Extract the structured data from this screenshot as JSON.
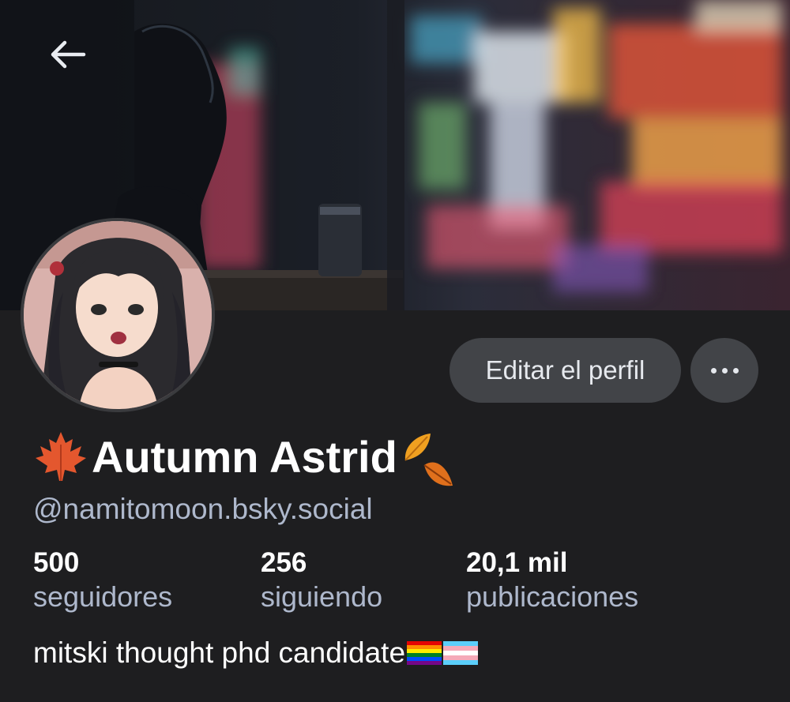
{
  "header": {
    "back_icon": "arrow-left-icon"
  },
  "profile": {
    "edit_label": "Editar el perfil",
    "more_icon": "ellipsis-icon",
    "display_name": "Autumn Astrid",
    "name_prefix_icon": "maple-leaf-icon",
    "name_suffix_icon": "fallen-leaves-icon",
    "handle": "@namitomoon.bsky.social",
    "bio_text": "mitski thought phd candidate",
    "bio_icons": [
      "rainbow-flag-icon",
      "transgender-flag-icon"
    ]
  },
  "stats": [
    {
      "value": "500",
      "label": "seguidores"
    },
    {
      "value": "256",
      "label": "siguiendo"
    },
    {
      "value": "20,1 mil",
      "label": "publicaciones"
    }
  ],
  "colors": {
    "background": "#1e1e20",
    "button_bg": "#424448",
    "secondary_text": "#aeb8cc",
    "maple_leaf": "#e4572e",
    "fallen_leaf": "#f0a020"
  }
}
